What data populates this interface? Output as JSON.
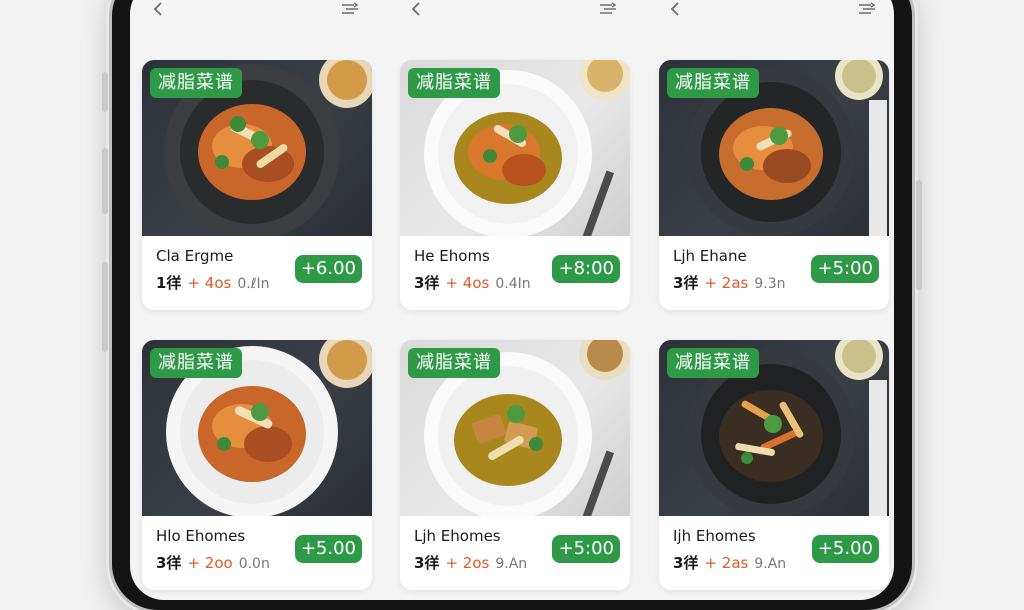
{
  "colors": {
    "accent_green": "#2e9a47",
    "time_orange": "#e05a23",
    "frame": "#141414"
  },
  "columns": [
    {
      "back_icon": "chevron-left-icon",
      "menu_icon": "sort-menu-icon"
    },
    {
      "back_icon": "chevron-left-icon",
      "menu_icon": "sort-menu-icon"
    },
    {
      "back_icon": "chevron-left-icon",
      "menu_icon": "sort-menu-icon"
    }
  ],
  "cards": [
    {
      "tag": "减脂菜谱",
      "name": "Cla Ergme",
      "qty": "1徉",
      "plus": "+",
      "time": "4os",
      "dist": "0.ℓIn",
      "price": "+6.00"
    },
    {
      "tag": "减脂菜谱",
      "name": "He Ehoms",
      "qty": "3徉",
      "plus": "+",
      "time": "4os",
      "dist": "0.4In",
      "price": "+8:00"
    },
    {
      "tag": "减脂菜谱",
      "name": "Ljh Ehane",
      "qty": "3徉",
      "plus": "+",
      "time": "2as",
      "dist": "9.3n",
      "price": "+5:00"
    },
    {
      "tag": "减脂菜谱",
      "name": "Hlo Ehomes",
      "qty": "3徉",
      "plus": "+",
      "time": "2oo",
      "dist": "0.0n",
      "price": "+5.00"
    },
    {
      "tag": "减脂菜谱",
      "name": "Ljh Ehomes",
      "qty": "3徉",
      "plus": "+",
      "time": "2os",
      "dist": "9.An",
      "price": "+5:00"
    },
    {
      "tag": "减脂菜谱",
      "name": "Ijh Ehomes",
      "qty": "3徉",
      "plus": "+",
      "time": "2as",
      "dist": "9.An",
      "price": "+5.00"
    }
  ]
}
